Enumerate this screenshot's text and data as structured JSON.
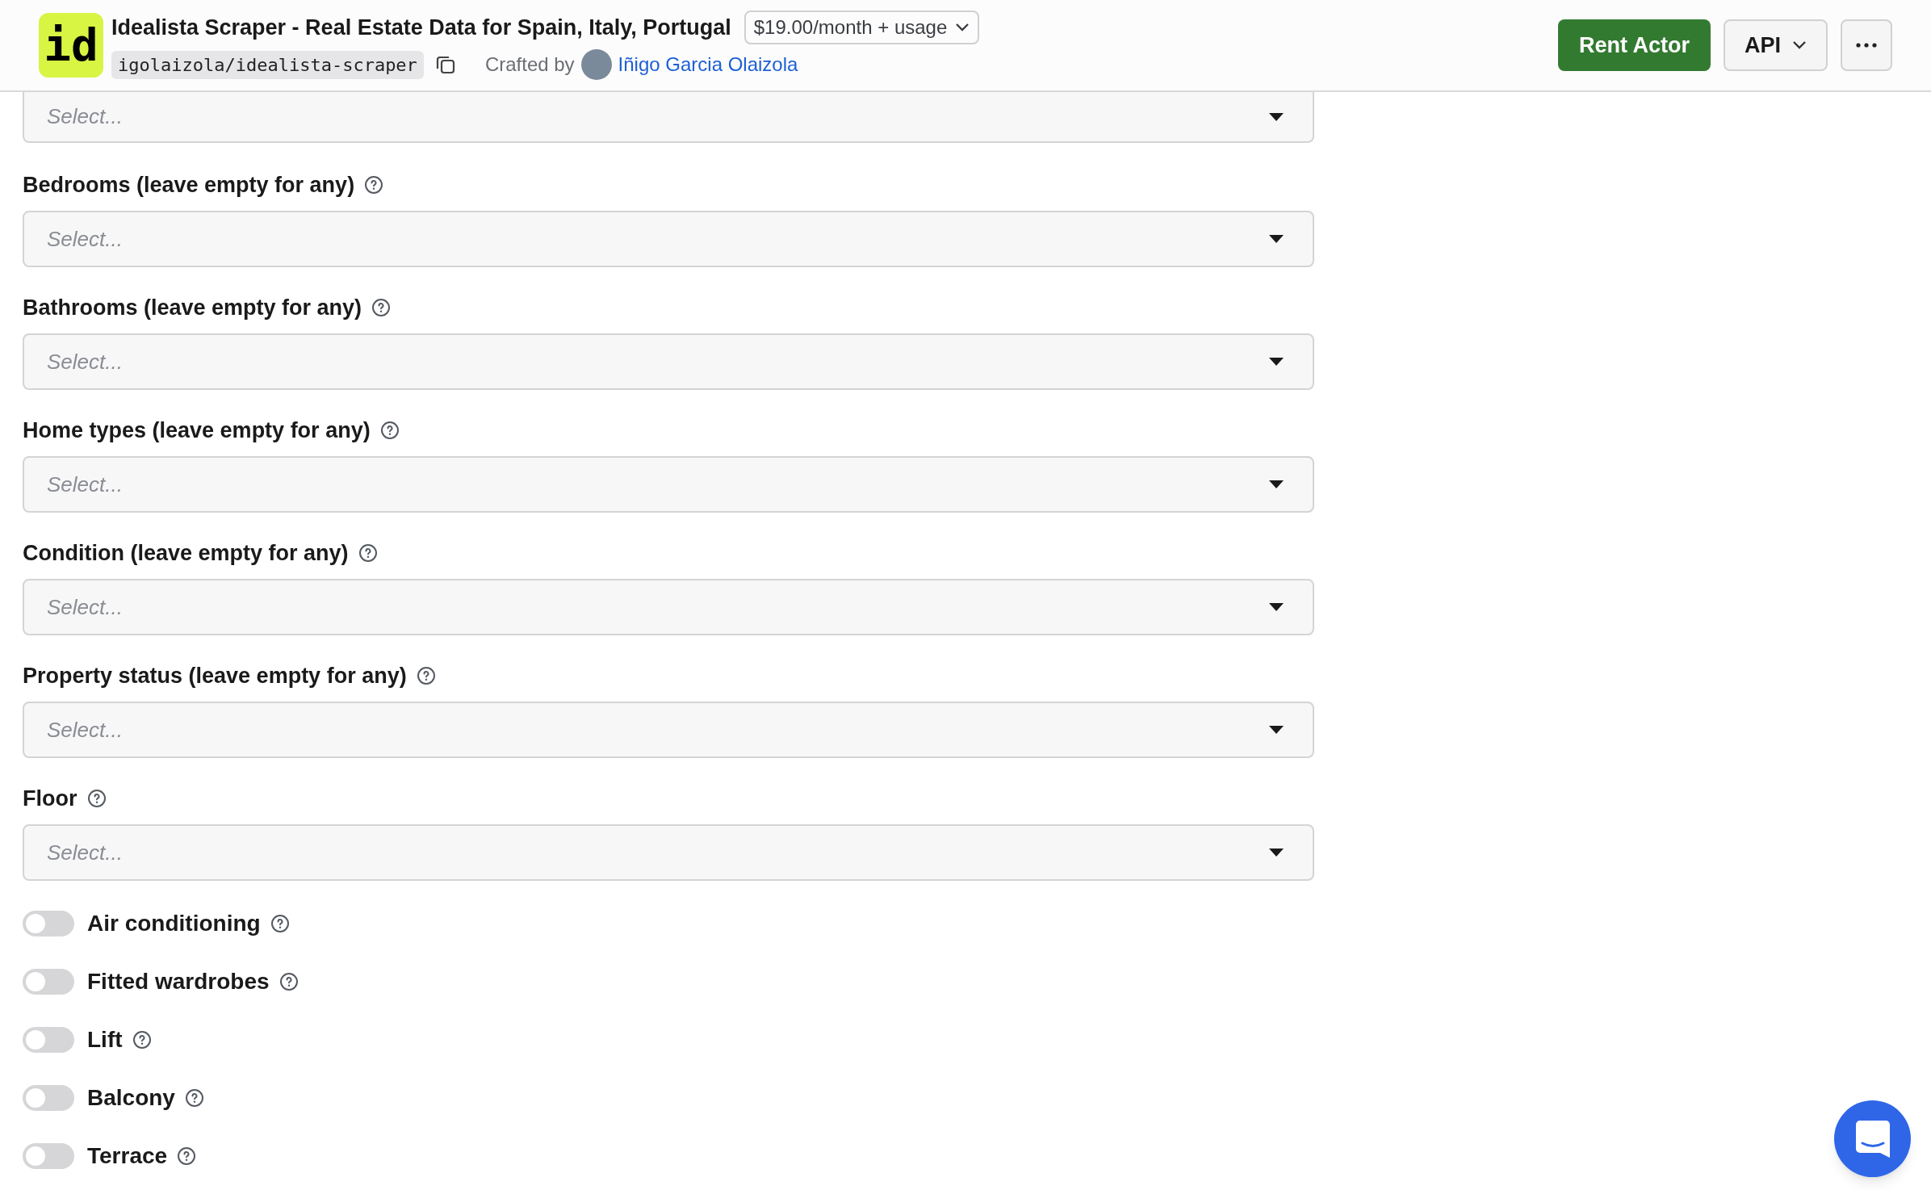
{
  "header": {
    "logo": "id",
    "title": "Idealista Scraper - Real Estate Data for Spain, Italy, Portugal",
    "pricing": "$19.00/month + usage",
    "slug": "igolaizola/idealista-scraper",
    "crafted_by": "Crafted by",
    "author": "Iñigo Garcia Olaizola",
    "rent_button": "Rent Actor",
    "api_button": "API"
  },
  "top_select": {
    "placeholder": "Select..."
  },
  "fields": [
    {
      "label": "Bedrooms (leave empty for any)",
      "placeholder": "Select..."
    },
    {
      "label": "Bathrooms (leave empty for any)",
      "placeholder": "Select..."
    },
    {
      "label": "Home types (leave empty for any)",
      "placeholder": "Select..."
    },
    {
      "label": "Condition (leave empty for any)",
      "placeholder": "Select..."
    },
    {
      "label": "Property status (leave empty for any)",
      "placeholder": "Select..."
    },
    {
      "label": "Floor",
      "placeholder": "Select..."
    }
  ],
  "toggles": [
    {
      "label": "Air conditioning",
      "on": false
    },
    {
      "label": "Fitted wardrobes",
      "on": false
    },
    {
      "label": "Lift",
      "on": false
    },
    {
      "label": "Balcony",
      "on": false
    },
    {
      "label": "Terrace",
      "on": false
    }
  ]
}
